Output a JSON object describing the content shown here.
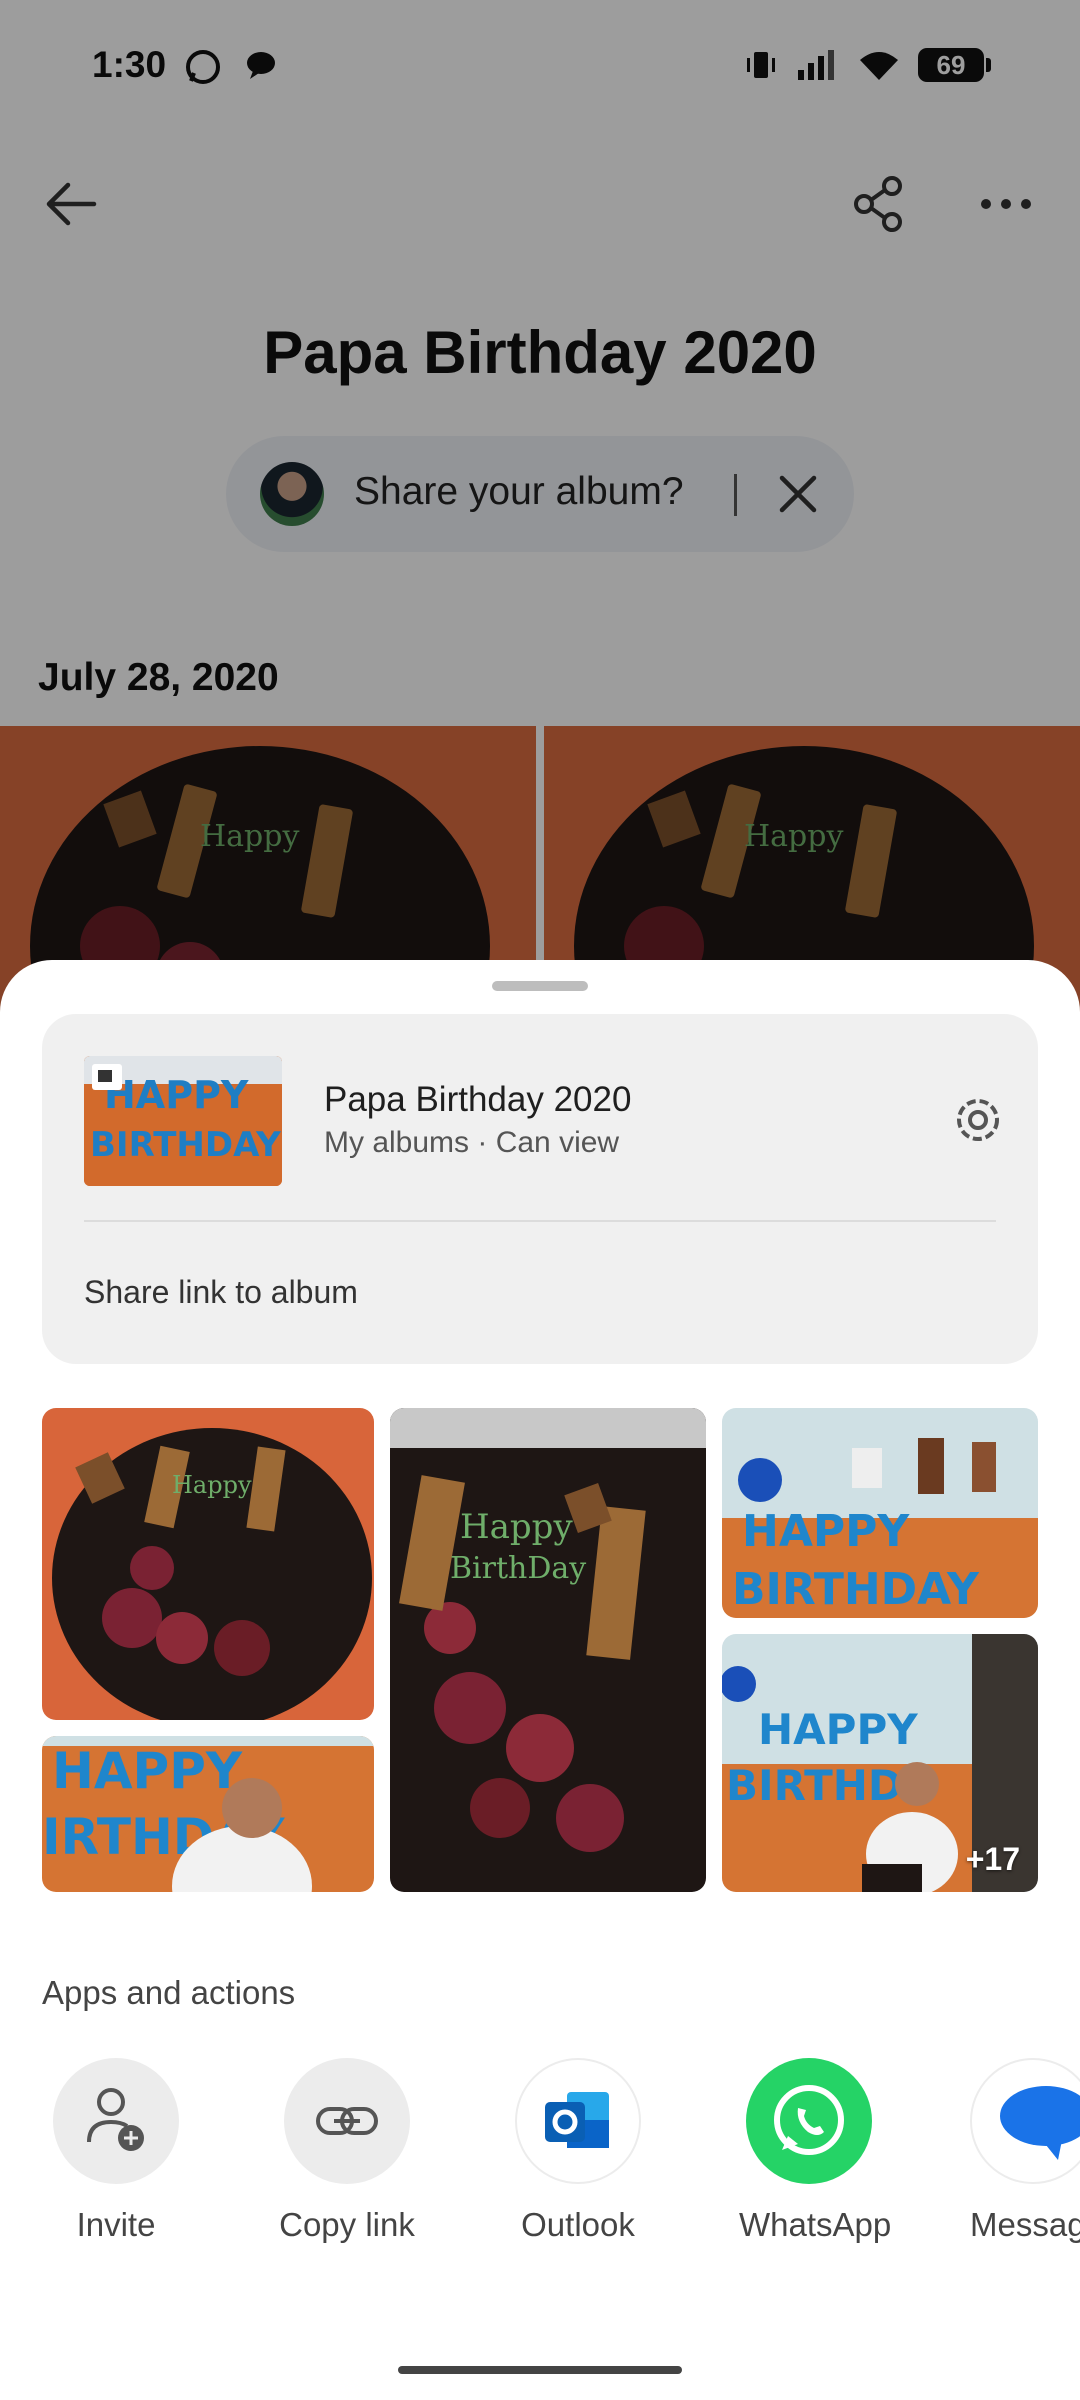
{
  "status_bar": {
    "time": "1:30",
    "battery": "69",
    "icons": [
      "whatsapp-icon",
      "chat-bubble-icon",
      "vibrate-icon",
      "signal-icon",
      "wifi-icon",
      "battery-icon"
    ]
  },
  "header": {
    "back_icon": "arrow-back-icon",
    "share_icon": "share-icon",
    "more_icon": "more-horizontal-icon"
  },
  "album": {
    "title": "Papa Birthday 2020",
    "share_prompt": "Share your album?",
    "date": "July 28, 2020"
  },
  "sheet": {
    "album_card": {
      "name": "Papa Birthday 2020",
      "subtitle": "My albums · Can view",
      "share_link_label": "Share link to album",
      "settings_icon": "gear-icon"
    },
    "more_count": "+17",
    "apps_section_title": "Apps and actions",
    "apps": [
      {
        "label": "Invite",
        "icon": "add-person-icon"
      },
      {
        "label": "Copy link",
        "icon": "link-icon"
      },
      {
        "label": "Outlook",
        "icon": "outlook-icon"
      },
      {
        "label": "WhatsApp",
        "icon": "whatsapp-icon"
      },
      {
        "label": "Messag",
        "icon": "messages-icon"
      }
    ]
  },
  "colors": {
    "whatsapp": "#25d366",
    "outlook": "#0a64c8",
    "messages": "#1a73e8",
    "sheet_card": "#f0f0f0"
  }
}
